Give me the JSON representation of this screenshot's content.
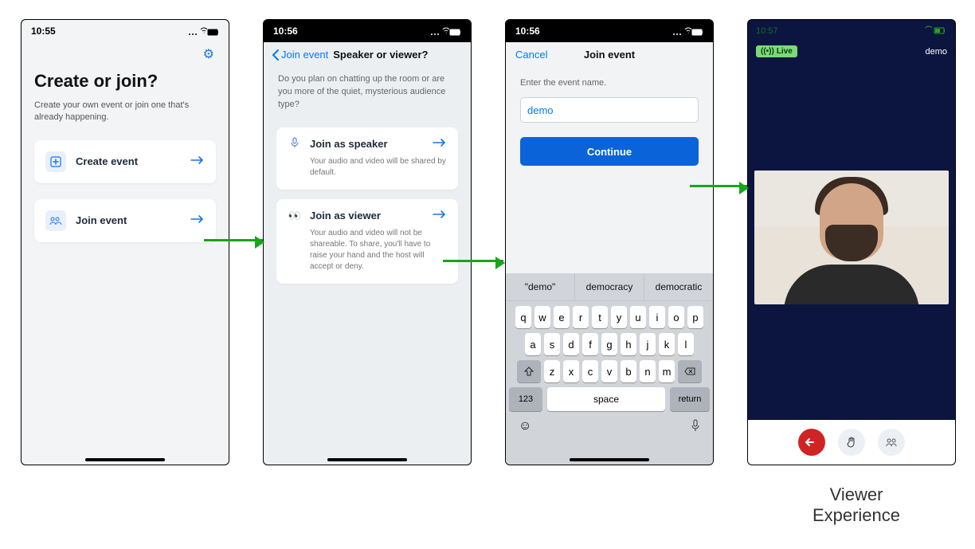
{
  "phone1": {
    "time": "10:55",
    "title": "Create or join?",
    "subtitle": "Create your own event or join one that's already happening.",
    "create_label": "Create event",
    "join_label": "Join event"
  },
  "phone2": {
    "time": "10:56",
    "back_label": "Join event",
    "title": "Speaker or viewer?",
    "desc": "Do you plan on chatting up the room or are you more of the quiet, mysterious audience type?",
    "speaker": {
      "title": "Join as speaker",
      "desc": "Your audio and video will be shared by default."
    },
    "viewer": {
      "title": "Join as viewer",
      "desc": "Your audio and video will not be shareable. To share, you'll have to raise your hand and the host will accept or deny."
    }
  },
  "phone3": {
    "time": "10:56",
    "cancel": "Cancel",
    "title": "Join event",
    "hint": "Enter the event name.",
    "input_value": "demo",
    "continue": "Continue",
    "suggestions": [
      "\"demo\"",
      "democracy",
      "democratic"
    ],
    "row1": [
      "q",
      "w",
      "e",
      "r",
      "t",
      "y",
      "u",
      "i",
      "o",
      "p"
    ],
    "row2": [
      "a",
      "s",
      "d",
      "f",
      "g",
      "h",
      "j",
      "k",
      "l"
    ],
    "row3": [
      "z",
      "x",
      "c",
      "v",
      "b",
      "n",
      "m"
    ],
    "key_123": "123",
    "key_space": "space",
    "key_return": "return"
  },
  "phone4": {
    "time": "10:57",
    "live": "Live",
    "event_name": "demo"
  },
  "caption": {
    "line1": "Viewer",
    "line2": "Experience"
  }
}
